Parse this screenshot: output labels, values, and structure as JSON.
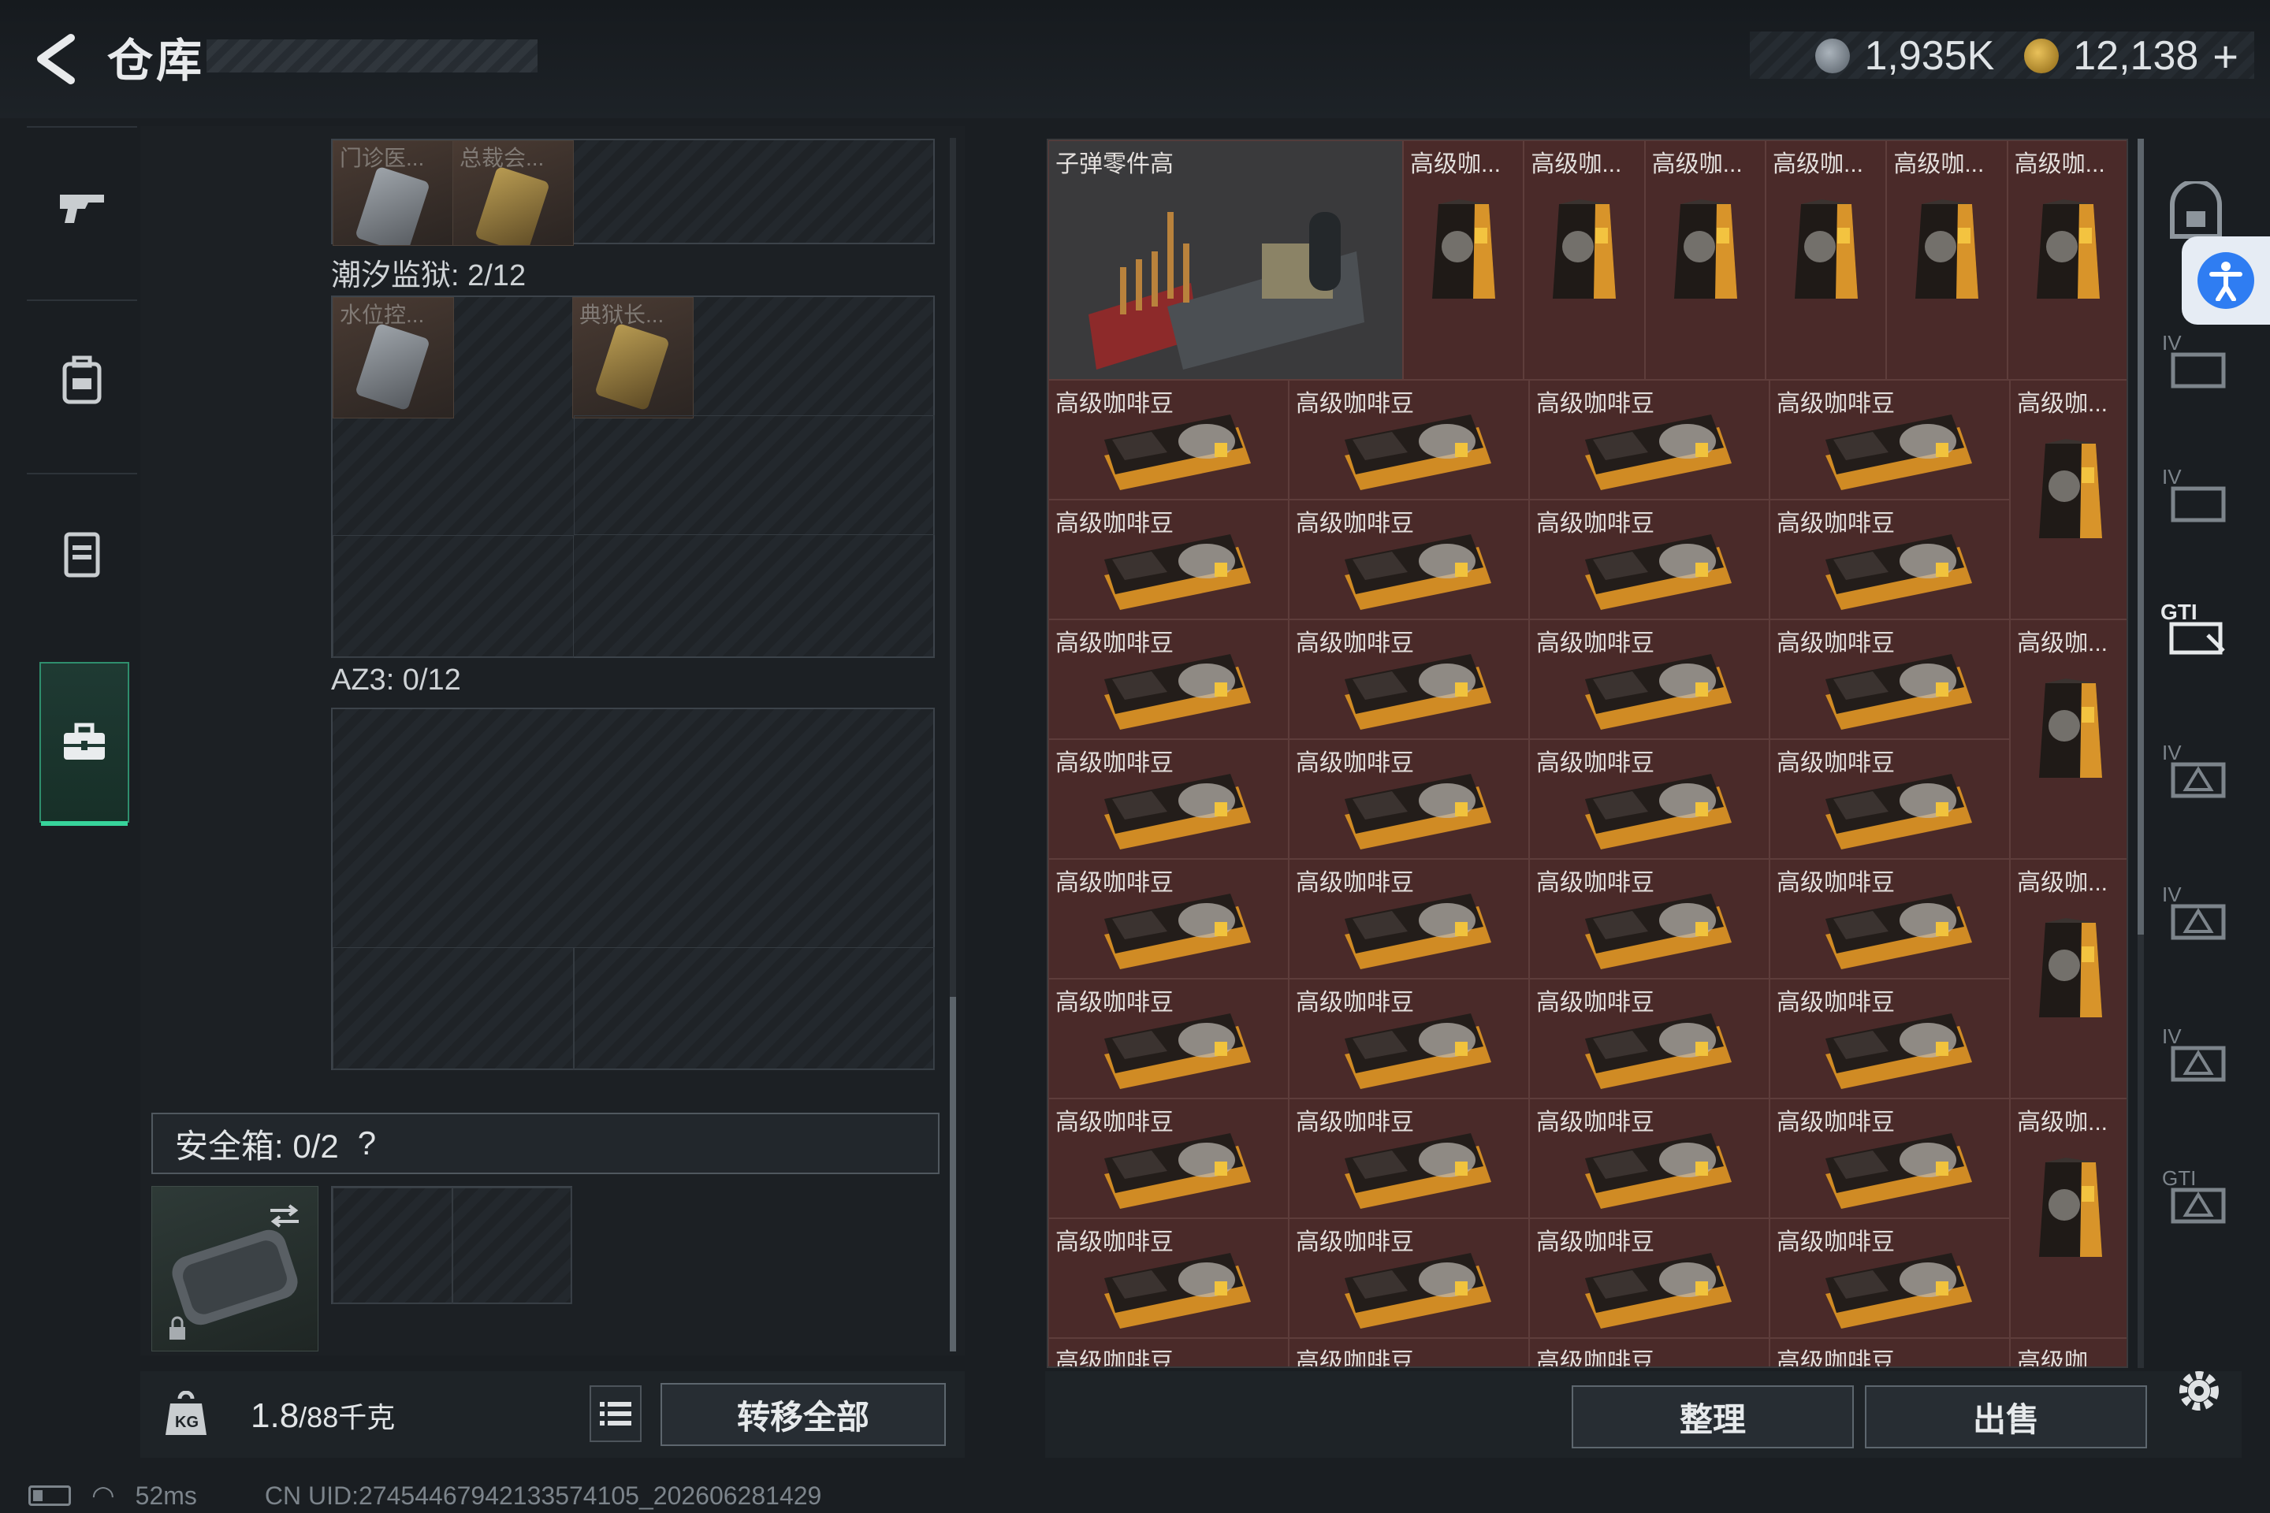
{
  "header": {
    "title": "仓库",
    "currency_1": "1,935K",
    "currency_2": "12,138",
    "add_symbol": "+"
  },
  "left_nav": {
    "items": [
      "gun-icon",
      "backpack-icon",
      "vest-icon",
      "toolbox-icon"
    ],
    "active": "toolbox-icon"
  },
  "containers": [
    {
      "keys": [
        {
          "label": "门诊医..."
        },
        {
          "label": "总裁会..."
        }
      ]
    },
    {
      "title": "潮汐监狱: 2/12",
      "keys": [
        {
          "label": "水位控..."
        },
        {
          "label": "典狱长..."
        }
      ]
    },
    {
      "title": "AZ3: 0/12"
    }
  ],
  "safe_box": {
    "title": "安全箱: 0/2",
    "help": "?"
  },
  "footer_left": {
    "weight_value": "1.8",
    "weight_unit": "/88千克",
    "transfer_label": "转移全部"
  },
  "status_bar": {
    "ping": "52ms",
    "uid": "CN UID:274544679421335741​05_202606281429"
  },
  "stash": {
    "featured_item": "子弹零件高",
    "truncated_name": "高级咖...",
    "full_name": "高级咖啡豆"
  },
  "footer_right": {
    "sort_label": "整理",
    "sell_label": "出售"
  },
  "colors": {
    "accent": "#37d39b",
    "item_bg": "#4a2a29",
    "a11y": "#2f7df2"
  }
}
